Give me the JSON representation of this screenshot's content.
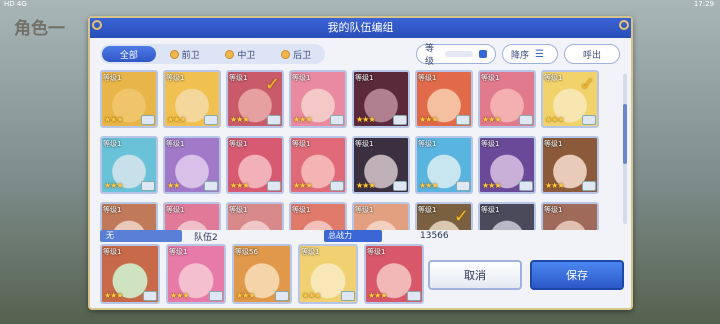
{
  "background": {
    "title": "角色一"
  },
  "status": {
    "left": "HD 4G",
    "right": "17:29"
  },
  "dialog": {
    "title": "我的队伍编组"
  },
  "filters": [
    {
      "label": "全部",
      "active": true
    },
    {
      "label": "前卫",
      "active": false
    },
    {
      "label": "中卫",
      "active": false
    },
    {
      "label": "后卫",
      "active": false
    }
  ],
  "sort": {
    "level_label": "等级",
    "order_label": "降序",
    "call_label": "呼出"
  },
  "grid": {
    "rows": [
      [
        {
          "level": "等级1",
          "stars": "★★★",
          "color": "#f0c46a",
          "hair": "#e8b648",
          "checked": false
        },
        {
          "level": "等级1",
          "stars": "★★★",
          "color": "#f4d79a",
          "hair": "#f0c050",
          "checked": false
        },
        {
          "level": "等级1",
          "stars": "★★★",
          "color": "#e6a0a0",
          "hair": "#c95a6a",
          "checked": true
        },
        {
          "level": "等级1",
          "stars": "★★★",
          "color": "#f5c8c8",
          "hair": "#e98aa0",
          "checked": false
        },
        {
          "level": "等级1",
          "stars": "★★★",
          "color": "#b08090",
          "hair": "#5a2a3a",
          "checked": false
        },
        {
          "level": "等级1",
          "stars": "★★★",
          "color": "#f4c0a0",
          "hair": "#e06a4a",
          "checked": false
        },
        {
          "level": "等级1",
          "stars": "★★★",
          "color": "#f4b0b0",
          "hair": "#e27a8e",
          "checked": false
        },
        {
          "level": "等级1",
          "stars": "★★★",
          "color": "#f8e6b0",
          "hair": "#f2d26a",
          "checked": true
        }
      ],
      [
        {
          "level": "等级1",
          "stars": "★★★",
          "color": "#c8e0ea",
          "hair": "#6ac2d8",
          "checked": false
        },
        {
          "level": "等级1",
          "stars": "★★",
          "color": "#d8c0e8",
          "hair": "#a07ac8",
          "checked": false
        },
        {
          "level": "等级1",
          "stars": "★★★",
          "color": "#f2b0b8",
          "hair": "#d85a72",
          "checked": false
        },
        {
          "level": "等级1",
          "stars": "★★★",
          "color": "#f4b4b4",
          "hair": "#e06a78",
          "checked": false
        },
        {
          "level": "等级1",
          "stars": "★★★",
          "color": "#c0b0b8",
          "hair": "#3a3040",
          "checked": false
        },
        {
          "level": "等级1",
          "stars": "★★★",
          "color": "#c8e6f0",
          "hair": "#5ab4e0",
          "checked": false
        },
        {
          "level": "等级1",
          "stars": "★★★",
          "color": "#c8b0d8",
          "hair": "#6a4a98",
          "checked": false
        },
        {
          "level": "等级1",
          "stars": "★★★",
          "color": "#e8cbb8",
          "hair": "#8a5a3a",
          "checked": false
        }
      ],
      [
        {
          "level": "等级1",
          "stars": "",
          "color": "#e8c8b8",
          "hair": "#c07a5a",
          "checked": false
        },
        {
          "level": "等级1",
          "stars": "",
          "color": "#f0c0c8",
          "hair": "#e07a98",
          "checked": false
        },
        {
          "level": "等级1",
          "stars": "",
          "color": "#f0c8c8",
          "hair": "#d88a8a",
          "checked": false
        },
        {
          "level": "等级1",
          "stars": "",
          "color": "#f2c2ba",
          "hair": "#e07a6a",
          "checked": false
        },
        {
          "level": "等级1",
          "stars": "",
          "color": "#f4d0c0",
          "hair": "#e2a080",
          "checked": false
        },
        {
          "level": "等级1",
          "stars": "",
          "color": "#d8c8b0",
          "hair": "#7a6040",
          "checked": true
        },
        {
          "level": "等级1",
          "stars": "",
          "color": "#b8b8c8",
          "hair": "#4a4a5a",
          "checked": false
        },
        {
          "level": "等级1",
          "stars": "",
          "color": "#e0c0b0",
          "hair": "#a06a5a",
          "checked": false
        }
      ]
    ]
  },
  "team": {
    "tag": "无",
    "name": "队伍2",
    "power_label": "总战力",
    "power_value": "13566",
    "members": [
      {
        "level": "等级1",
        "stars": "★★★",
        "color": "#cfe3c0",
        "hair": "#c86a4a"
      },
      {
        "level": "等级1",
        "stars": "★★★",
        "color": "#f4c0d0",
        "hair": "#e87aa8"
      },
      {
        "level": "等级56",
        "stars": "★★★",
        "color": "#f4d4a8",
        "hair": "#e0984a"
      },
      {
        "level": "等级1",
        "stars": "★★★",
        "color": "#f8e8b8",
        "hair": "#f0d070"
      },
      {
        "level": "等级1",
        "stars": "★★★",
        "color": "#f2b8b8",
        "hair": "#d8586a"
      }
    ]
  },
  "buttons": {
    "cancel": "取消",
    "save": "保存"
  }
}
